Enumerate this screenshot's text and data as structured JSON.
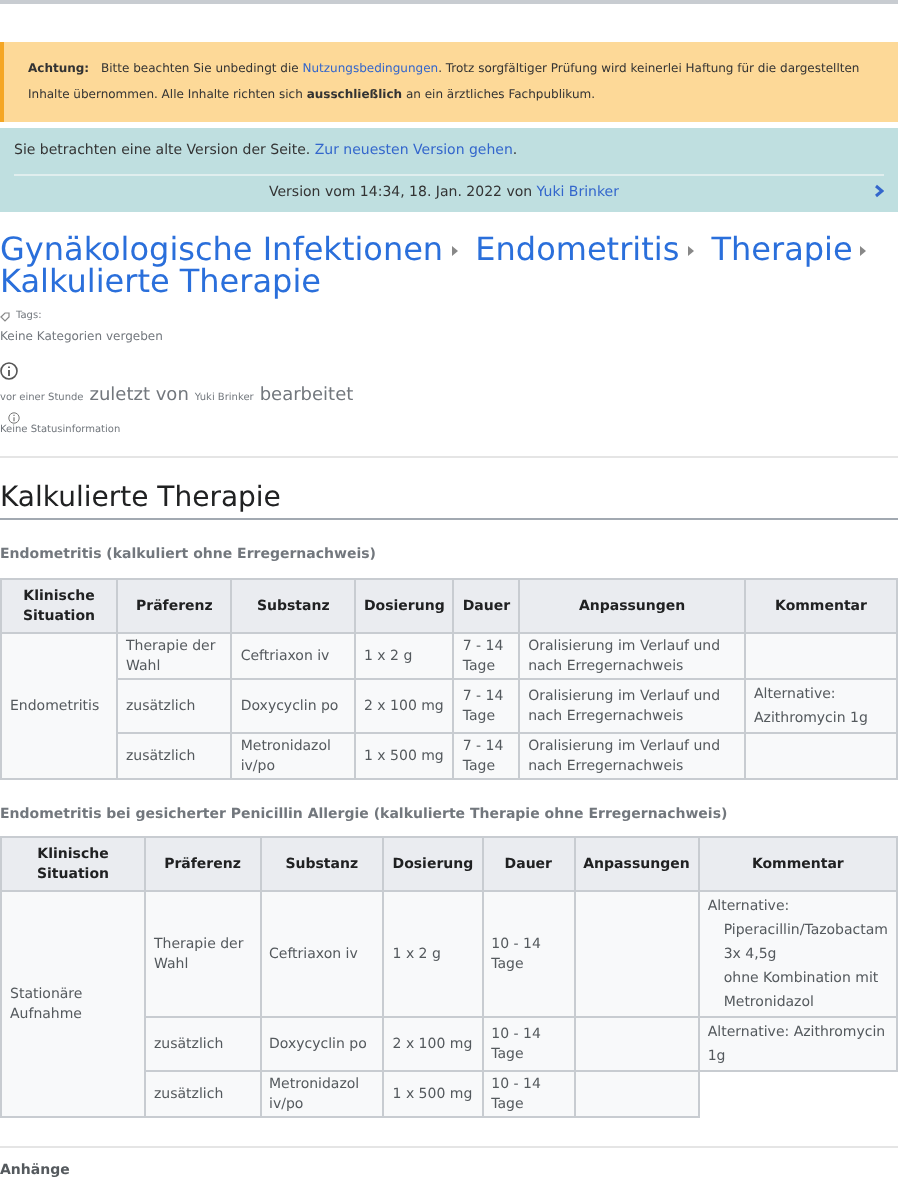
{
  "warning": {
    "label": "Achtung:",
    "before": "Bitte beachten Sie unbedingt die",
    "link": "Nutzungsbedingungen",
    "after": ". Trotz sorgfältiger Prüfung wird keinerlei Haftung für die dargestellten Inhalte übernommen. Alle Inhalte richten sich **ausschließlich** an ein ärztliches Fachpublikum."
  },
  "version_notice": {
    "text": "Sie betrachten eine alte Version der Seite.",
    "link": "Zur neuesten Version gehen",
    "after": ".",
    "version_text": "Version vom 14:34, 18. Jan. 2022 von",
    "author": "Yuki Brinker"
  },
  "breadcrumbs": [
    "Gynäkologische Infektionen",
    "Endometritis",
    "Therapie",
    "Kalkulierte Therapie"
  ],
  "meta": {
    "tags_label": "Tags:",
    "categories": "Keine Kategorien vergeben",
    "time": "vor einer Stunde",
    "edited_by": "zuletzt von",
    "author": "Yuki Brinker",
    "edited": "bearbeitet",
    "status": "Keine Statusinformation"
  },
  "section_title": "Kalkulierte Therapie",
  "tables": [
    {
      "caption": "Endometritis (kalkuliert ohne Erregernachweis)",
      "columns": [
        "Klinische Situation",
        "Präferenz",
        "Substanz",
        "Dosierung",
        "Dauer",
        "Anpassungen",
        "Kommentar"
      ],
      "situation": "Endometritis",
      "rows": [
        {
          "preference": "Therapie der Wahl",
          "substance": "Ceftriaxon iv",
          "dose": "1 x 2 g",
          "duration": "7 - 14 Tage",
          "adjustments": "Oralisierung im Verlauf und nach Erregernachweis",
          "comment": []
        },
        {
          "preference": "zusätzlich",
          "substance": "Doxycyclin po",
          "dose": "2 x 100 mg",
          "duration": "7 - 14 Tage",
          "adjustments": "Oralisierung im Verlauf und nach Erregernachweis",
          "comment": [
            "Alternative: Azithromycin 1g"
          ]
        },
        {
          "preference": "zusätzlich",
          "substance": "Metronidazol iv/po",
          "dose": "1 x 500 mg",
          "duration": "7 - 14 Tage",
          "adjustments": "Oralisierung im Verlauf und nach Erregernachweis",
          "comment": []
        }
      ]
    },
    {
      "caption": "Endometritis bei gesicherter Penicillin Allergie (kalkulierte Therapie ohne Erregernachweis)",
      "columns": [
        "Klinische Situation",
        "Präferenz",
        "Substanz",
        "Dosierung",
        "Dauer",
        "Anpassungen",
        "Kommentar"
      ],
      "situation": "Stationäre Aufnahme",
      "rows": [
        {
          "preference": "Therapie der Wahl",
          "substance": "Ceftriaxon iv",
          "dose": "1 x 2 g",
          "duration": "10 - 14 Tage",
          "adjustments": "",
          "comment": [
            "Alternative:",
            "Piperacillin/Tazobactam",
            "3x 4,5g",
            "ohne Kombination mit",
            "Metronidazol"
          ]
        },
        {
          "preference": "zusätzlich",
          "substance": "Doxycyclin po",
          "dose": "2 x 100 mg",
          "duration": "10 - 14 Tage",
          "adjustments": "",
          "comment": [
            "Alternative: Azithromycin 1g"
          ]
        },
        {
          "preference": "zusätzlich",
          "substance": "Metronidazol iv/po",
          "dose": "1 x 500 mg",
          "duration": "10 - 14 Tage",
          "adjustments": ""
        }
      ]
    }
  ],
  "attachments_title": "Anhänge"
}
